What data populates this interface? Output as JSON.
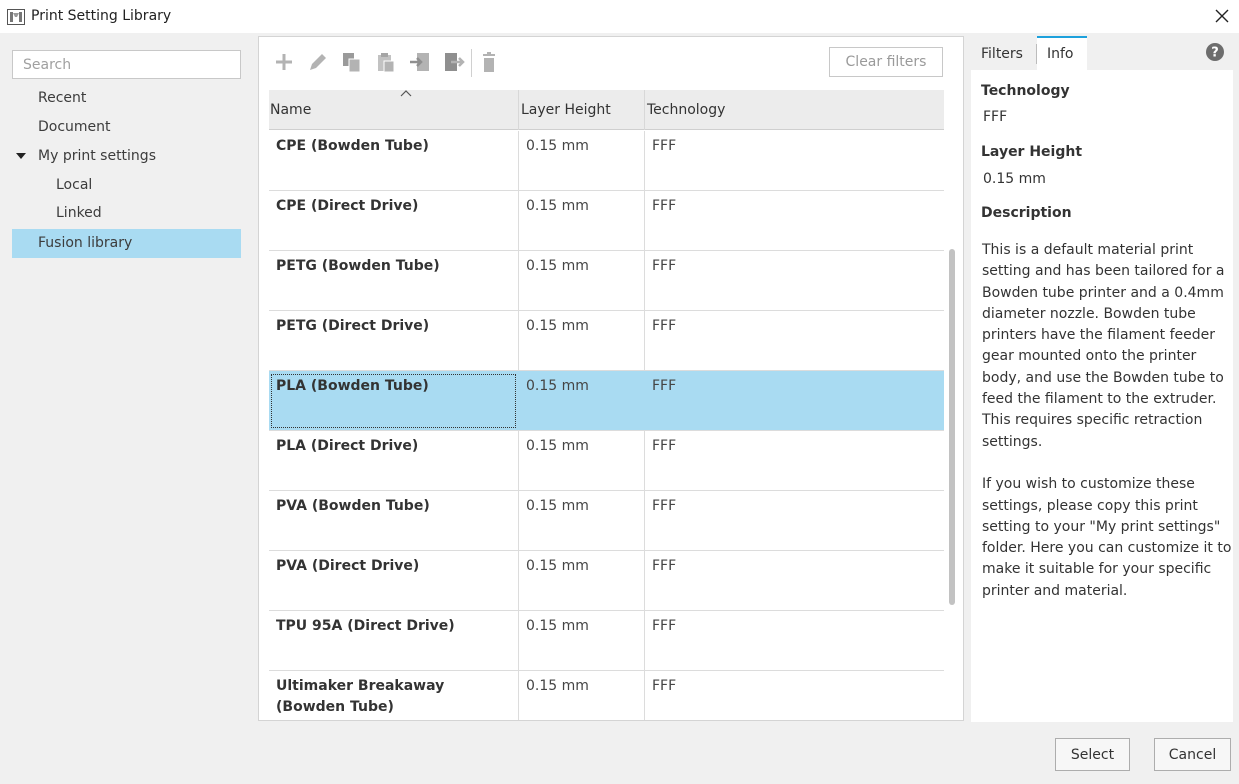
{
  "window": {
    "title": "Print Setting Library"
  },
  "sidebar": {
    "search_placeholder": "Search",
    "items": [
      {
        "label": "Recent"
      },
      {
        "label": "Document"
      },
      {
        "label": "My print settings"
      },
      {
        "label": "Local"
      },
      {
        "label": "Linked"
      },
      {
        "label": "Fusion library",
        "selected": true
      }
    ]
  },
  "toolbar": {
    "clear_filters": "Clear filters",
    "icons": [
      "add-icon",
      "edit-icon",
      "copy-icon",
      "paste-icon",
      "import-icon",
      "export-icon",
      "delete-icon"
    ]
  },
  "table": {
    "columns": [
      "Name",
      "Layer Height",
      "Technology"
    ],
    "rows": [
      {
        "name": "CPE (Bowden Tube)",
        "layer_height": "0.15 mm",
        "technology": "FFF"
      },
      {
        "name": "CPE (Direct Drive)",
        "layer_height": "0.15 mm",
        "technology": "FFF"
      },
      {
        "name": "PETG (Bowden Tube)",
        "layer_height": "0.15 mm",
        "technology": "FFF"
      },
      {
        "name": "PETG (Direct Drive)",
        "layer_height": "0.15 mm",
        "technology": "FFF"
      },
      {
        "name": "PLA (Bowden Tube)",
        "layer_height": "0.15 mm",
        "technology": "FFF",
        "selected": true
      },
      {
        "name": "PLA (Direct Drive)",
        "layer_height": "0.15 mm",
        "technology": "FFF"
      },
      {
        "name": "PVA (Bowden Tube)",
        "layer_height": "0.15 mm",
        "technology": "FFF"
      },
      {
        "name": "PVA (Direct Drive)",
        "layer_height": "0.15 mm",
        "technology": "FFF"
      },
      {
        "name": "TPU 95A (Direct Drive)",
        "layer_height": "0.15 mm",
        "technology": "FFF"
      },
      {
        "name": "Ultimaker Breakaway (Bowden Tube)",
        "layer_height": "0.15 mm",
        "technology": "FFF"
      }
    ]
  },
  "details": {
    "tabs": [
      "Filters",
      "Info"
    ],
    "active_tab": "Info",
    "technology_label": "Technology",
    "technology_value": "FFF",
    "layer_height_label": "Layer Height",
    "layer_height_value": "0.15 mm",
    "description_label": "Description",
    "description_p1": "This is a default material print setting and has been tailored for a Bowden tube printer and a 0.4mm diameter nozzle. Bowden tube printers have the filament feeder gear mounted onto the printer body, and use the Bowden tube to feed the filament to the extruder. This requires specific retraction settings.",
    "description_p2": "If you wish to customize these settings, please copy this print setting to your \"My print settings\" folder. Here you can customize it to make it suitable for your specific printer and material."
  },
  "footer": {
    "select_label": "Select",
    "cancel_label": "Cancel"
  },
  "colors": {
    "selection": "#a9dbf2",
    "active_tab_accent": "#1ea1dc"
  }
}
